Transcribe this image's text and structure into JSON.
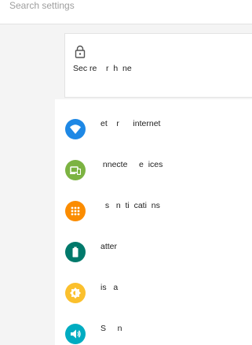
{
  "search": {
    "placeholder": "Search settings"
  },
  "banner": {
    "icon": "lock-icon",
    "text": "Sec re    r  h  ne"
  },
  "settings_items": [
    {
      "icon": "wifi-icon",
      "color": "#1e88e5",
      "label": "et    r      internet"
    },
    {
      "icon": "devices-icon",
      "color": "#7cb342",
      "label": " nnecte     e  ices"
    },
    {
      "icon": "apps-grid-icon",
      "color": "#fb8c00",
      "label": "  s   n  ti  cati  ns"
    },
    {
      "icon": "battery-icon",
      "color": "#00796b",
      "label": "atter"
    },
    {
      "icon": "brightness-icon",
      "color": "#fbc02d",
      "label": "is   a"
    },
    {
      "icon": "volume-icon",
      "color": "#00acc1",
      "label": "S     n"
    }
  ]
}
